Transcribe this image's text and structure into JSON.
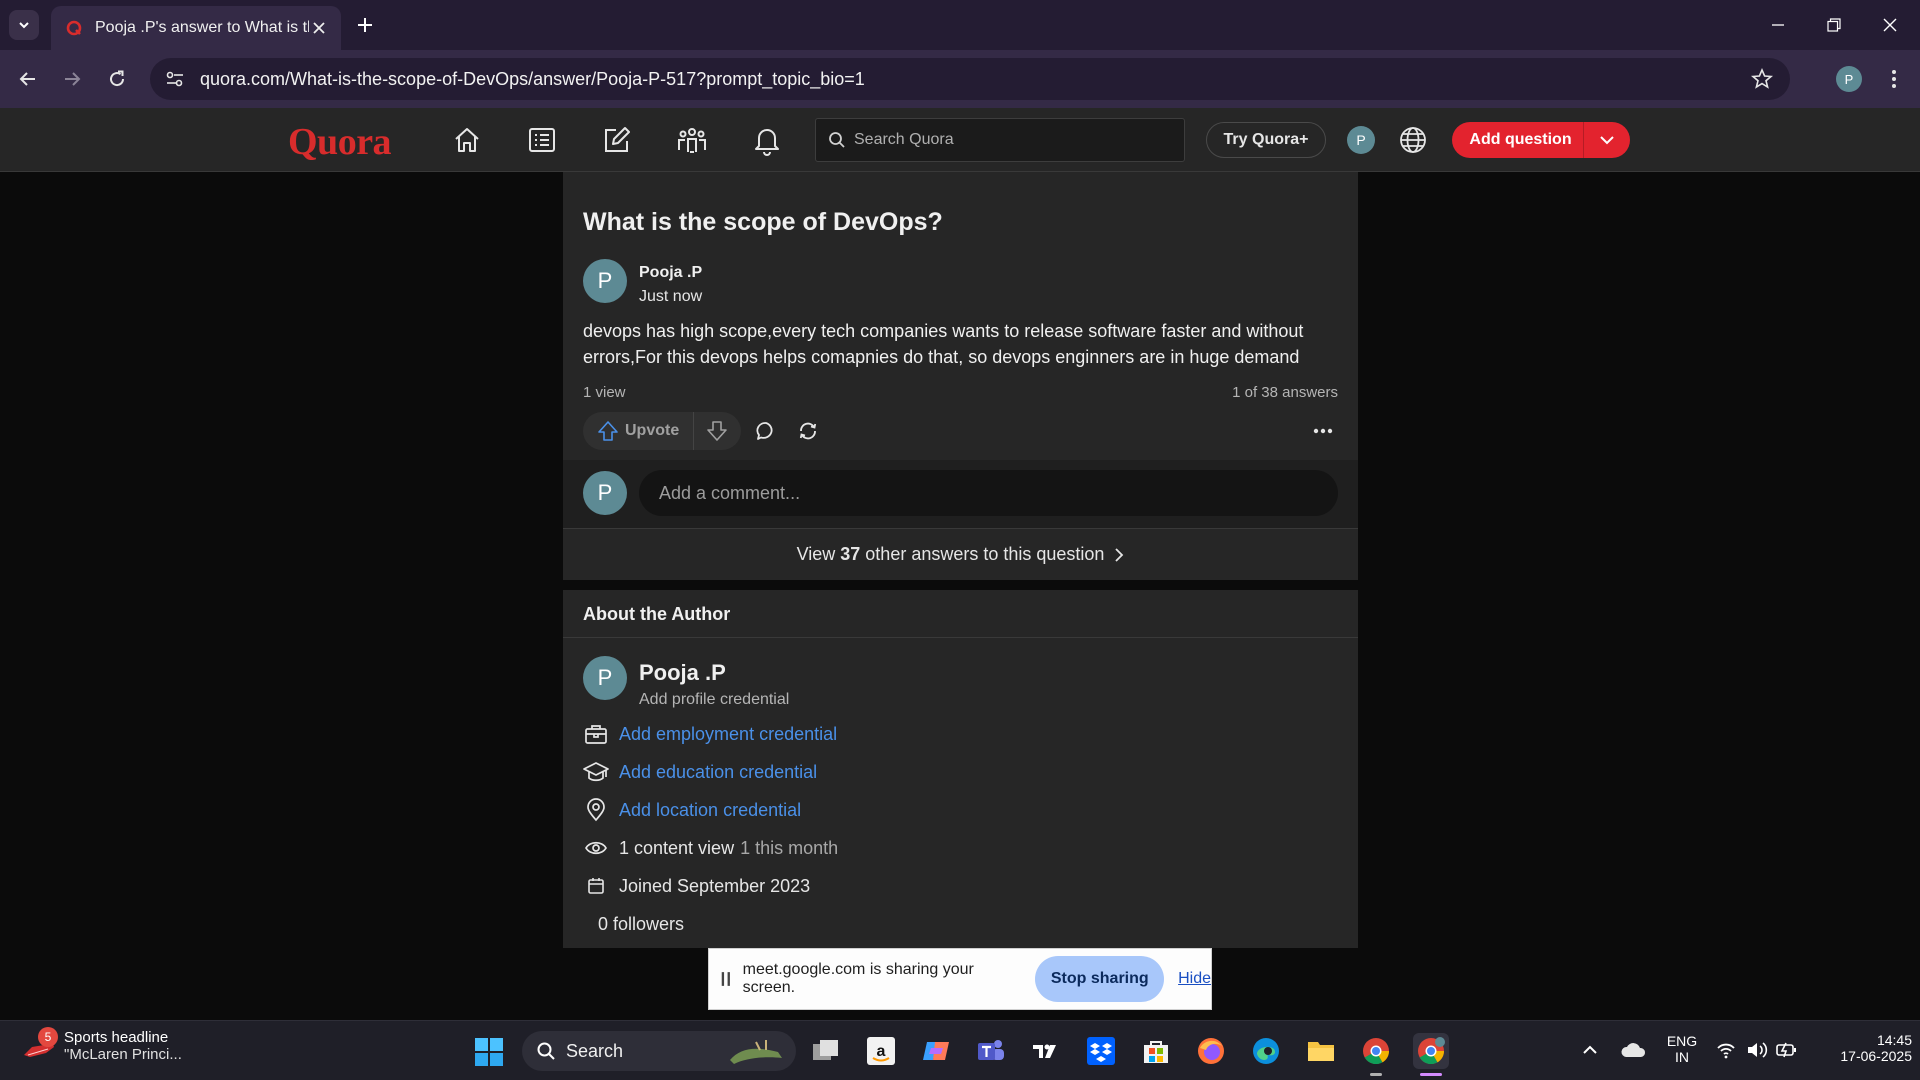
{
  "browser": {
    "tab_title": "Pooja .P's answer to What is the scope of DevOps?",
    "url": "quora.com/What-is-the-scope-of-DevOps/answer/Pooja-P-517?prompt_topic_bio=1",
    "profile_initial": "P"
  },
  "quora_header": {
    "logo": "Quora",
    "search_placeholder": "Search Quora",
    "try_plus": "Try Quora+",
    "avatar_initial": "P",
    "add_question": "Add question"
  },
  "answer": {
    "question_title": "What is the scope of DevOps?",
    "author_initial": "P",
    "author_name": "Pooja .P",
    "timestamp": "Just now",
    "body": "devops has high scope,every tech companies wants to release software faster and without errors,For this devops helps comapnies do that, so devops enginners are in huge demand",
    "views": "1 view",
    "position": "1 of 38 answers",
    "upvote_label": "Upvote",
    "comment_placeholder": "Add a comment...",
    "view_others_prefix": "View",
    "view_others_count": "37",
    "view_others_suffix": "other answers to this question"
  },
  "about_author": {
    "heading": "About the Author",
    "initial": "P",
    "name": "Pooja .P",
    "credential": "Add profile credential",
    "employment": "Add employment credential",
    "education": "Add education credential",
    "location": "Add location credential",
    "content_views": "1 content view",
    "content_views_period": "1 this month",
    "joined": "Joined September 2023",
    "followers": "0 followers"
  },
  "share_bar": {
    "message": "meet.google.com is sharing your screen.",
    "stop": "Stop sharing",
    "hide": "Hide"
  },
  "taskbar": {
    "news_badge": "5",
    "news_title": "Sports headline",
    "news_sub": "\"McLaren Princi...",
    "search_label": "Search",
    "lang_top": "ENG",
    "lang_bottom": "IN",
    "time": "14:45",
    "date": "17-06-2025"
  },
  "colors": {
    "quora_red": "#d82c2c",
    "add_question_bg": "#e3232e",
    "link_blue": "#4a90e8",
    "page_bg": "#0b0b0b",
    "card_bg": "#262626"
  }
}
